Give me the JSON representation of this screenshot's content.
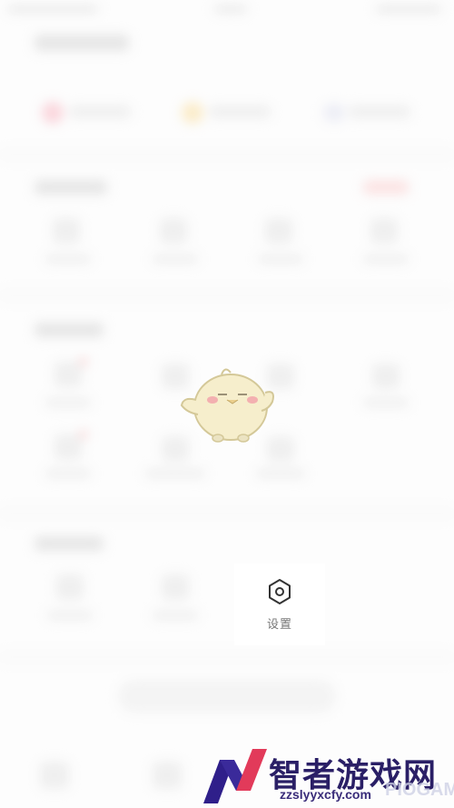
{
  "settings": {
    "label": "设置",
    "icon": "hexagon-gear-icon"
  },
  "watermark": {
    "brand": "智者游戏网",
    "url": "zzslyyxcfy.com",
    "ghost": "PIOGAME"
  },
  "colors": {
    "background": "#fafafa",
    "brand": "#2a1f66"
  }
}
